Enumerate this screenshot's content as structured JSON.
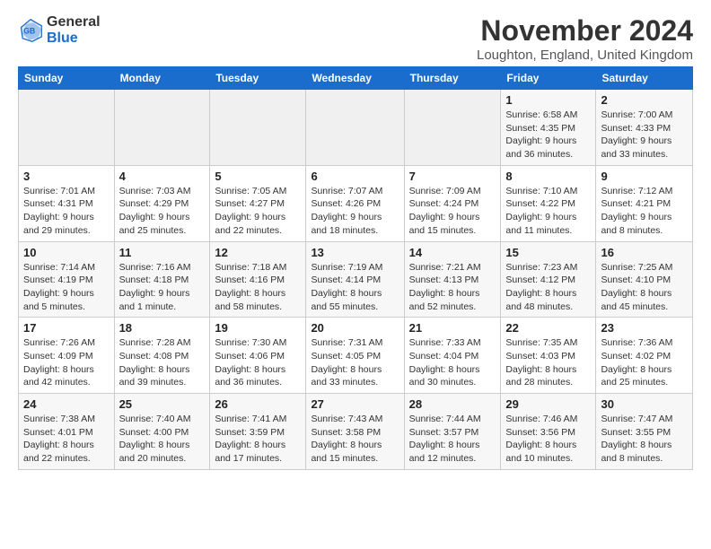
{
  "logo": {
    "text_general": "General",
    "text_blue": "Blue"
  },
  "title": "November 2024",
  "subtitle": "Loughton, England, United Kingdom",
  "headers": [
    "Sunday",
    "Monday",
    "Tuesday",
    "Wednesday",
    "Thursday",
    "Friday",
    "Saturday"
  ],
  "weeks": [
    [
      {
        "day": "",
        "info": ""
      },
      {
        "day": "",
        "info": ""
      },
      {
        "day": "",
        "info": ""
      },
      {
        "day": "",
        "info": ""
      },
      {
        "day": "",
        "info": ""
      },
      {
        "day": "1",
        "info": "Sunrise: 6:58 AM\nSunset: 4:35 PM\nDaylight: 9 hours and 36 minutes."
      },
      {
        "day": "2",
        "info": "Sunrise: 7:00 AM\nSunset: 4:33 PM\nDaylight: 9 hours and 33 minutes."
      }
    ],
    [
      {
        "day": "3",
        "info": "Sunrise: 7:01 AM\nSunset: 4:31 PM\nDaylight: 9 hours and 29 minutes."
      },
      {
        "day": "4",
        "info": "Sunrise: 7:03 AM\nSunset: 4:29 PM\nDaylight: 9 hours and 25 minutes."
      },
      {
        "day": "5",
        "info": "Sunrise: 7:05 AM\nSunset: 4:27 PM\nDaylight: 9 hours and 22 minutes."
      },
      {
        "day": "6",
        "info": "Sunrise: 7:07 AM\nSunset: 4:26 PM\nDaylight: 9 hours and 18 minutes."
      },
      {
        "day": "7",
        "info": "Sunrise: 7:09 AM\nSunset: 4:24 PM\nDaylight: 9 hours and 15 minutes."
      },
      {
        "day": "8",
        "info": "Sunrise: 7:10 AM\nSunset: 4:22 PM\nDaylight: 9 hours and 11 minutes."
      },
      {
        "day": "9",
        "info": "Sunrise: 7:12 AM\nSunset: 4:21 PM\nDaylight: 9 hours and 8 minutes."
      }
    ],
    [
      {
        "day": "10",
        "info": "Sunrise: 7:14 AM\nSunset: 4:19 PM\nDaylight: 9 hours and 5 minutes."
      },
      {
        "day": "11",
        "info": "Sunrise: 7:16 AM\nSunset: 4:18 PM\nDaylight: 9 hours and 1 minute."
      },
      {
        "day": "12",
        "info": "Sunrise: 7:18 AM\nSunset: 4:16 PM\nDaylight: 8 hours and 58 minutes."
      },
      {
        "day": "13",
        "info": "Sunrise: 7:19 AM\nSunset: 4:14 PM\nDaylight: 8 hours and 55 minutes."
      },
      {
        "day": "14",
        "info": "Sunrise: 7:21 AM\nSunset: 4:13 PM\nDaylight: 8 hours and 52 minutes."
      },
      {
        "day": "15",
        "info": "Sunrise: 7:23 AM\nSunset: 4:12 PM\nDaylight: 8 hours and 48 minutes."
      },
      {
        "day": "16",
        "info": "Sunrise: 7:25 AM\nSunset: 4:10 PM\nDaylight: 8 hours and 45 minutes."
      }
    ],
    [
      {
        "day": "17",
        "info": "Sunrise: 7:26 AM\nSunset: 4:09 PM\nDaylight: 8 hours and 42 minutes."
      },
      {
        "day": "18",
        "info": "Sunrise: 7:28 AM\nSunset: 4:08 PM\nDaylight: 8 hours and 39 minutes."
      },
      {
        "day": "19",
        "info": "Sunrise: 7:30 AM\nSunset: 4:06 PM\nDaylight: 8 hours and 36 minutes."
      },
      {
        "day": "20",
        "info": "Sunrise: 7:31 AM\nSunset: 4:05 PM\nDaylight: 8 hours and 33 minutes."
      },
      {
        "day": "21",
        "info": "Sunrise: 7:33 AM\nSunset: 4:04 PM\nDaylight: 8 hours and 30 minutes."
      },
      {
        "day": "22",
        "info": "Sunrise: 7:35 AM\nSunset: 4:03 PM\nDaylight: 8 hours and 28 minutes."
      },
      {
        "day": "23",
        "info": "Sunrise: 7:36 AM\nSunset: 4:02 PM\nDaylight: 8 hours and 25 minutes."
      }
    ],
    [
      {
        "day": "24",
        "info": "Sunrise: 7:38 AM\nSunset: 4:01 PM\nDaylight: 8 hours and 22 minutes."
      },
      {
        "day": "25",
        "info": "Sunrise: 7:40 AM\nSunset: 4:00 PM\nDaylight: 8 hours and 20 minutes."
      },
      {
        "day": "26",
        "info": "Sunrise: 7:41 AM\nSunset: 3:59 PM\nDaylight: 8 hours and 17 minutes."
      },
      {
        "day": "27",
        "info": "Sunrise: 7:43 AM\nSunset: 3:58 PM\nDaylight: 8 hours and 15 minutes."
      },
      {
        "day": "28",
        "info": "Sunrise: 7:44 AM\nSunset: 3:57 PM\nDaylight: 8 hours and 12 minutes."
      },
      {
        "day": "29",
        "info": "Sunrise: 7:46 AM\nSunset: 3:56 PM\nDaylight: 8 hours and 10 minutes."
      },
      {
        "day": "30",
        "info": "Sunrise: 7:47 AM\nSunset: 3:55 PM\nDaylight: 8 hours and 8 minutes."
      }
    ]
  ]
}
